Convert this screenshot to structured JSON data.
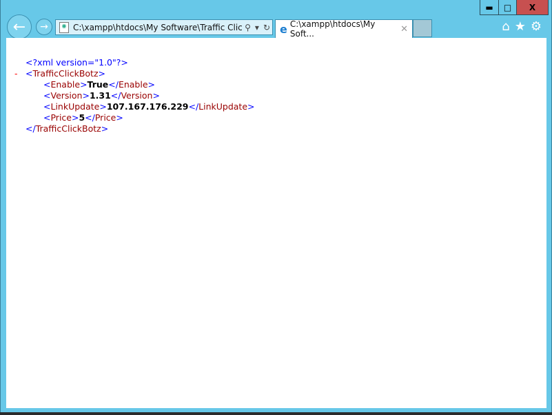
{
  "window": {
    "minimize": "▬",
    "maximize": "□",
    "close": "X"
  },
  "toolbar": {
    "address": "C:\\xampp\\htdocs\\My Software\\Traffic Click",
    "tab_title": "C:\\xampp\\htdocs\\My Soft...",
    "tab_close": "✕"
  },
  "xml": {
    "decl": "<?xml version=\"1.0\"?>",
    "toggle": "-",
    "root": "TrafficClickBotz",
    "children": [
      {
        "tag": "Enable",
        "value": "True"
      },
      {
        "tag": "Version",
        "value": "1.31"
      },
      {
        "tag": "LinkUpdate",
        "value": "107.167.176.229"
      },
      {
        "tag": "Price",
        "value": "5"
      }
    ]
  }
}
